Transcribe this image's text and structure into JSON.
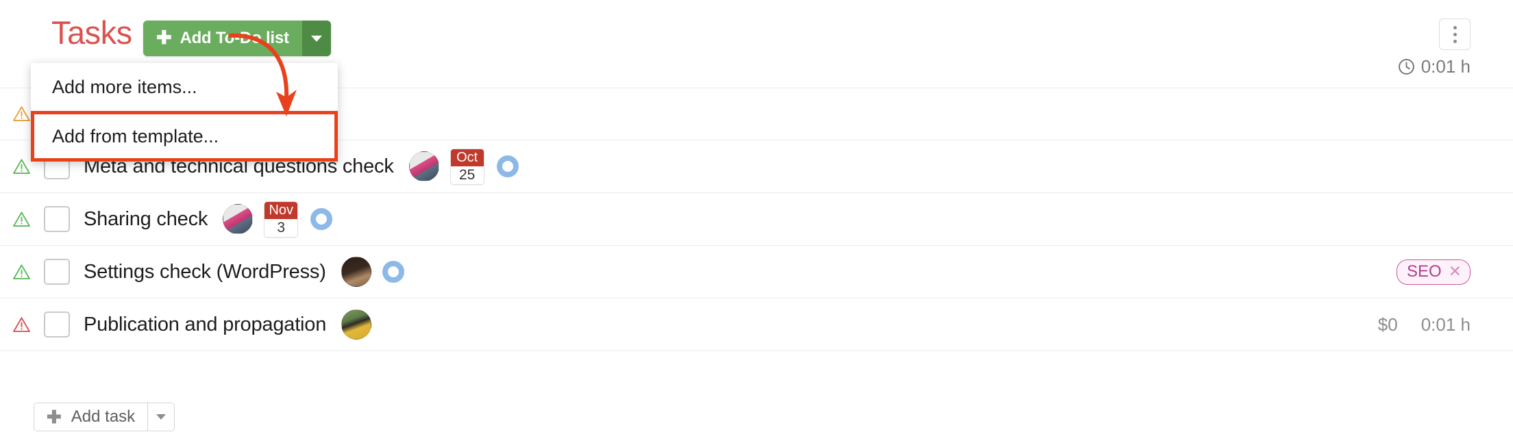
{
  "header": {
    "title": "Tasks",
    "add_todo_label": "Add To-Do list",
    "add_todo_plus": "✚",
    "kebab_name": "more-options",
    "time_label": "0:01 h"
  },
  "dropdown": {
    "items": [
      {
        "label": "Add more items...",
        "highlighted": false
      },
      {
        "label": "Add from template...",
        "highlighted": true
      }
    ]
  },
  "tasks": [
    {
      "title": "",
      "warn_color": "#e8a33d",
      "avatar_colors": [
        "#c8c8c8",
        "#9a9a9a"
      ],
      "has_avatar": false,
      "date": null,
      "donut": true,
      "tag": null,
      "cost": "",
      "time": ""
    },
    {
      "title": "Meta and technical questions check",
      "warn_color": "#5cb85c",
      "avatar_colors": [
        "#d94f86",
        "#6b4b3a"
      ],
      "has_avatar": true,
      "date": {
        "month": "Oct",
        "day": "25"
      },
      "donut": true,
      "tag": null,
      "cost": "",
      "time": ""
    },
    {
      "title": "Sharing check",
      "warn_color": "#5cb85c",
      "avatar_colors": [
        "#d94f86",
        "#6b4b3a"
      ],
      "has_avatar": true,
      "date": {
        "month": "Nov",
        "day": "3"
      },
      "donut": true,
      "tag": null,
      "cost": "",
      "time": ""
    },
    {
      "title": "Settings check (WordPress)",
      "warn_color": "#5cb85c",
      "avatar_colors": [
        "#3a2a20",
        "#b08a66"
      ],
      "has_avatar": true,
      "date": null,
      "donut": true,
      "tag": {
        "label": "SEO",
        "close": "✕"
      },
      "cost": "",
      "time": ""
    },
    {
      "title": "Publication and propagation",
      "warn_color": "#d9534f",
      "avatar_colors": [
        "#d9b44a",
        "#4e6b3a"
      ],
      "has_avatar": true,
      "date": null,
      "donut": false,
      "tag": null,
      "cost": "$0",
      "time": "0:01 h"
    }
  ],
  "footer": {
    "add_task_label": "Add task",
    "add_task_plus": "✚"
  },
  "colors": {
    "title": "#d9534f",
    "primary_green": "#6aad5e",
    "primary_green_dark": "#4e8b44",
    "annotation_red": "#e8411c",
    "donut_blue": "#8cb9e8",
    "tag_pink": "#b33d8c",
    "date_red": "#c0392b"
  }
}
